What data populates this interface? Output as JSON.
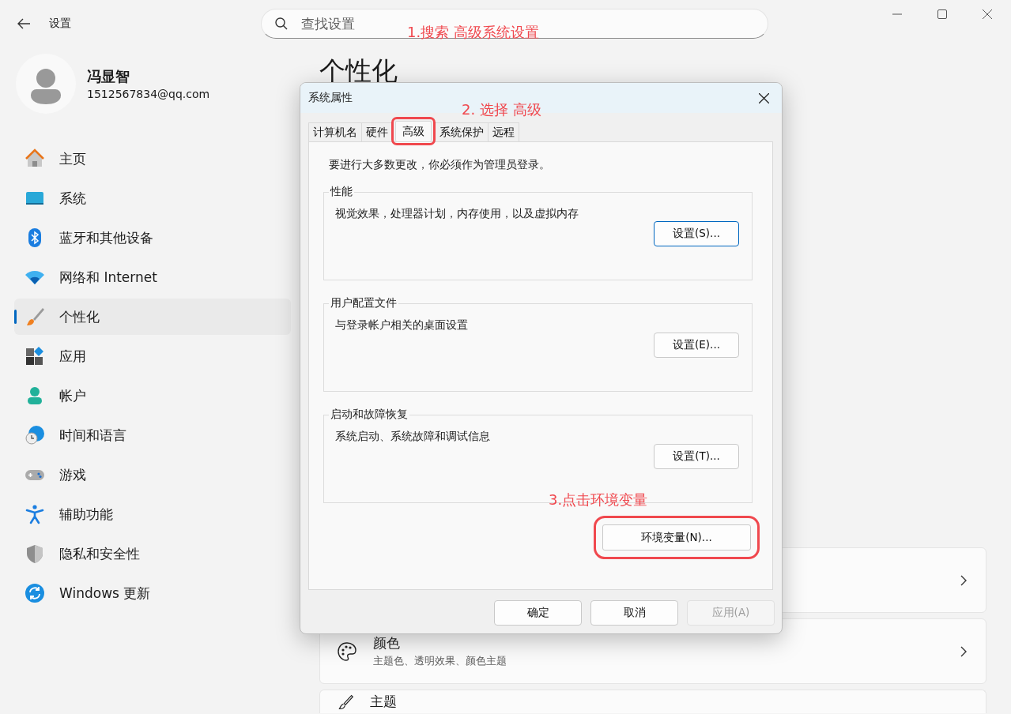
{
  "window": {
    "title": "设置"
  },
  "search": {
    "placeholder": "查找设置"
  },
  "account": {
    "name": "冯显智",
    "email": "1512567834@qq.com"
  },
  "sidebar": {
    "items": [
      {
        "label": "主页",
        "kind": "home",
        "selected": false
      },
      {
        "label": "系统",
        "kind": "system",
        "selected": false
      },
      {
        "label": "蓝牙和其他设备",
        "kind": "bluetooth",
        "selected": false
      },
      {
        "label": "网络和 Internet",
        "kind": "network",
        "selected": false
      },
      {
        "label": "个性化",
        "kind": "brush",
        "selected": true
      },
      {
        "label": "应用",
        "kind": "apps",
        "selected": false
      },
      {
        "label": "帐户",
        "kind": "account",
        "selected": false
      },
      {
        "label": "时间和语言",
        "kind": "time",
        "selected": false
      },
      {
        "label": "游戏",
        "kind": "gaming",
        "selected": false
      },
      {
        "label": "辅助功能",
        "kind": "accessibility",
        "selected": false
      },
      {
        "label": "隐私和安全性",
        "kind": "privacy",
        "selected": false
      },
      {
        "label": "Windows 更新",
        "kind": "update",
        "selected": false
      }
    ]
  },
  "page": {
    "title": "个性化",
    "cards": [
      {
        "kind": "covered"
      },
      {
        "kind": "palette",
        "title": "颜色",
        "subtitle": "主题色、透明效果、颜色主题"
      },
      {
        "kind": "theme",
        "title": "主题"
      }
    ]
  },
  "dialog": {
    "title": "系统属性",
    "tabs": [
      {
        "label": "计算机名",
        "selected": false,
        "marked": false
      },
      {
        "label": "硬件",
        "selected": false,
        "marked": false
      },
      {
        "label": "高级",
        "selected": true,
        "marked": true
      },
      {
        "label": "系统保护",
        "selected": false,
        "marked": false
      },
      {
        "label": "远程",
        "selected": false,
        "marked": false
      }
    ],
    "notice": "要进行大多数更改，你必须作为管理员登录。",
    "groups": [
      {
        "title": "性能",
        "description": "视觉效果，处理器计划，内存使用，以及虚拟内存",
        "button": "设置(S)...",
        "focused": true
      },
      {
        "title": "用户配置文件",
        "description": "与登录帐户相关的桌面设置",
        "button": "设置(E)...",
        "focused": false
      },
      {
        "title": "启动和故障恢复",
        "description": "系统启动、系统故障和调试信息",
        "button": "设置(T)...",
        "focused": false
      }
    ],
    "env_button": {
      "label": "环境变量(N)...",
      "marked": true
    },
    "buttons": [
      {
        "label": "确定",
        "disabled": false
      },
      {
        "label": "取消",
        "disabled": false
      },
      {
        "label": "应用(A)",
        "disabled": true
      }
    ]
  },
  "annotations": [
    {
      "kind": "search",
      "text": "1.搜索  高级系统设置"
    },
    {
      "kind": "tab",
      "text": "2. 选择 高级"
    },
    {
      "kind": "button",
      "text": "3.点击环境变量"
    }
  ]
}
